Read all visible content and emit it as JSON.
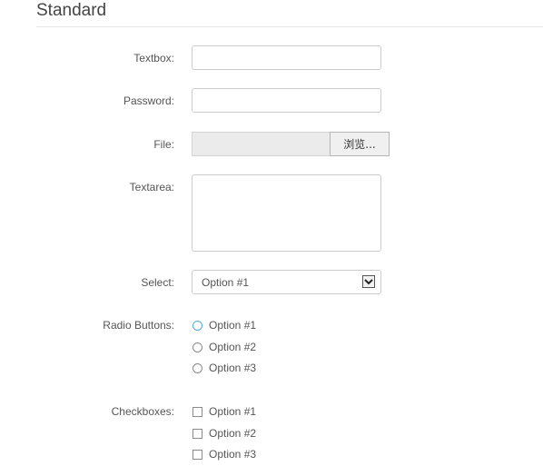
{
  "section": {
    "title": "Standard"
  },
  "form": {
    "textbox": {
      "label": "Textbox:",
      "value": "",
      "placeholder": ""
    },
    "password": {
      "label": "Password:",
      "value": "",
      "placeholder": ""
    },
    "file": {
      "label": "File:",
      "value": "",
      "browse_label": "浏览..."
    },
    "textarea": {
      "label": "Textarea:",
      "value": ""
    },
    "select": {
      "label": "Select:",
      "selected": "Option #1",
      "arrow_icon": "chevron-down-icon"
    },
    "radios": {
      "label": "Radio Buttons:",
      "options": [
        {
          "label": "Option #1",
          "checked": false,
          "focused": true
        },
        {
          "label": "Option #2",
          "checked": false,
          "focused": false
        },
        {
          "label": "Option #3",
          "checked": false,
          "focused": false
        }
      ]
    },
    "checkboxes": {
      "label": "Checkboxes:",
      "options": [
        {
          "label": "Option #1",
          "checked": false
        },
        {
          "label": "Option #2",
          "checked": false
        },
        {
          "label": "Option #3",
          "checked": false
        }
      ]
    }
  },
  "colors": {
    "focus_ring": "#5aa9d8",
    "border": "#cccccc",
    "text": "#555555"
  }
}
